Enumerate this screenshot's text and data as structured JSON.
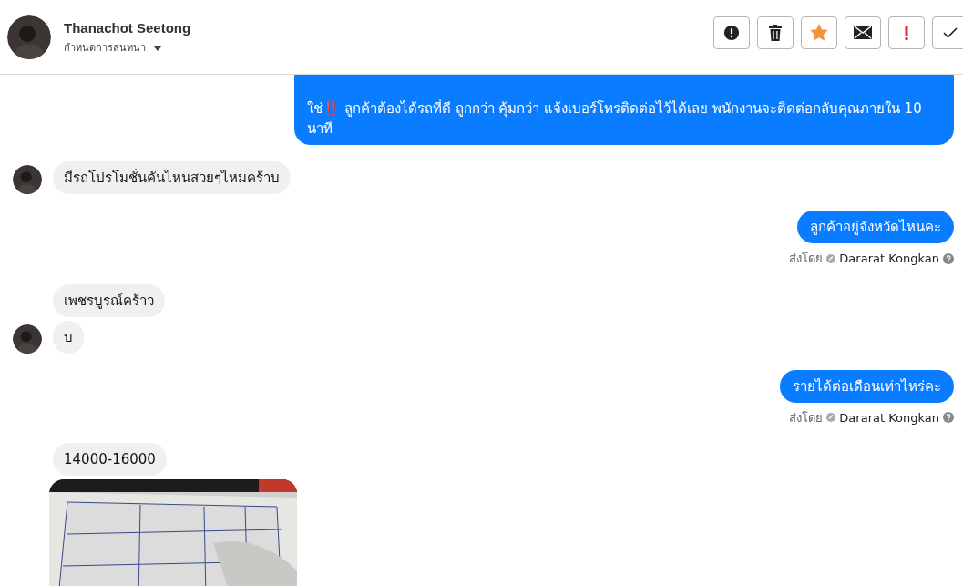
{
  "header": {
    "name": "Thanachot Seetong",
    "subtitle": "กำหนดการสนทนา",
    "toolbar": [
      {
        "kind": "alert"
      },
      {
        "kind": "trash"
      },
      {
        "kind": "star"
      },
      {
        "kind": "mail"
      },
      {
        "kind": "important"
      },
      {
        "kind": "check"
      }
    ]
  },
  "messages": [
    {
      "kind": "sent",
      "text": "ใช่‼️ ลูกค้าต้องได้รถที่ดี ถูกกว่า คุ้มกว่า แจ้งเบอร์โทรติดต่อไว้ได้เลย พนักงานจะติดต่อกลับคุณภายใน 10 นาที",
      "top_cut_off": true
    },
    {
      "kind": "received",
      "text": "มีรถโปรโมชั่นคันไหนสวยๆไหมคร้าบ",
      "avatar": true
    },
    {
      "kind": "sent",
      "text": "ลูกค้าอยู่จังหวัดไหนคะ",
      "sent_label": "ส่งโดย",
      "sender": "Dararat Kongkan"
    },
    {
      "kind": "received",
      "text": "เพชรบูรณ์คร้าว",
      "avatar": false
    },
    {
      "kind": "received",
      "text": "บ",
      "avatar": true
    },
    {
      "kind": "sent",
      "text": "รายได้ต่อเดือนเท่าไหร่คะ",
      "sent_label": "ส่งโดย",
      "sender": "Dararat Kongkan"
    },
    {
      "kind": "received",
      "text": "14000-16000",
      "avatar": false
    },
    {
      "kind": "picture"
    }
  ]
}
